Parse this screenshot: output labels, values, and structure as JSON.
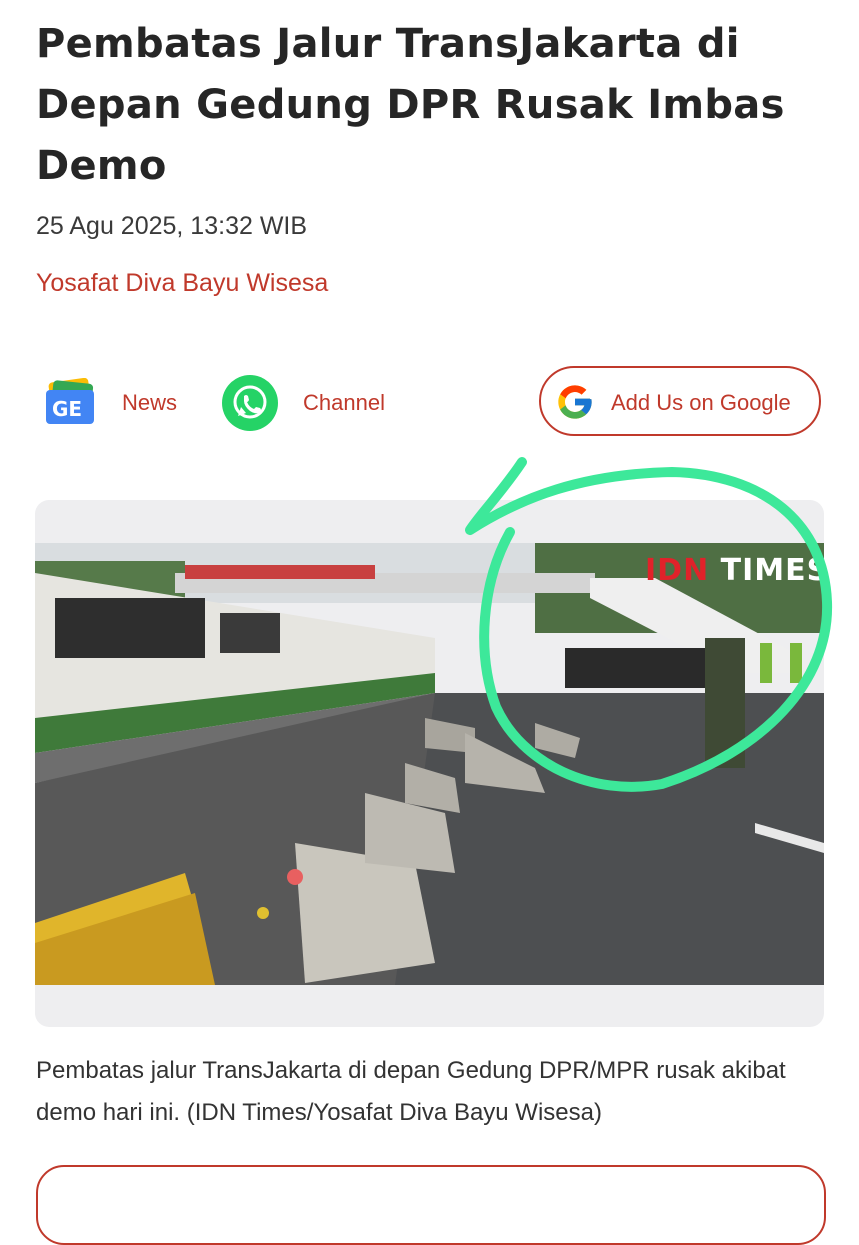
{
  "article": {
    "title": "Pembatas Jalur TransJakarta di Depan Gedung DPR Rusak Imbas Demo",
    "date": "25 Agu 2025, 13:32 WIB",
    "author": "Yosafat Diva Bayu Wisesa"
  },
  "follow": {
    "news_label": "News",
    "channel_label": "Channel",
    "google_label": "Add Us on Google"
  },
  "photo": {
    "watermark_idn": "IDN",
    "watermark_times": "TIMES",
    "caption": "Pembatas jalur TransJakarta di depan Gedung DPR/MPR rusak akibat demo hari ini. (IDN Times/Yosafat Diva Bayu Wisesa)"
  },
  "colors": {
    "accent": "#c0392b",
    "annotation": "#3de89a"
  }
}
